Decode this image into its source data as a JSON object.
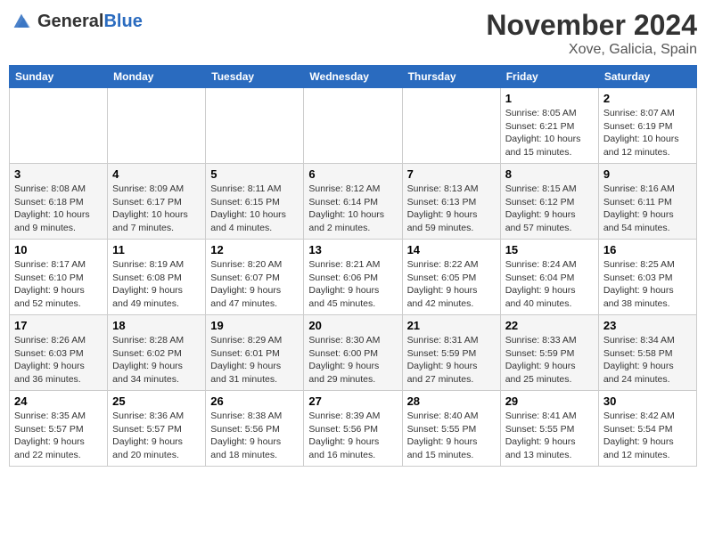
{
  "header": {
    "logo_general": "General",
    "logo_blue": "Blue",
    "month_title": "November 2024",
    "location": "Xove, Galicia, Spain"
  },
  "days_of_week": [
    "Sunday",
    "Monday",
    "Tuesday",
    "Wednesday",
    "Thursday",
    "Friday",
    "Saturday"
  ],
  "weeks": [
    [
      {
        "day": "",
        "info": ""
      },
      {
        "day": "",
        "info": ""
      },
      {
        "day": "",
        "info": ""
      },
      {
        "day": "",
        "info": ""
      },
      {
        "day": "",
        "info": ""
      },
      {
        "day": "1",
        "info": "Sunrise: 8:05 AM\nSunset: 6:21 PM\nDaylight: 10 hours and 15 minutes."
      },
      {
        "day": "2",
        "info": "Sunrise: 8:07 AM\nSunset: 6:19 PM\nDaylight: 10 hours and 12 minutes."
      }
    ],
    [
      {
        "day": "3",
        "info": "Sunrise: 8:08 AM\nSunset: 6:18 PM\nDaylight: 10 hours and 9 minutes."
      },
      {
        "day": "4",
        "info": "Sunrise: 8:09 AM\nSunset: 6:17 PM\nDaylight: 10 hours and 7 minutes."
      },
      {
        "day": "5",
        "info": "Sunrise: 8:11 AM\nSunset: 6:15 PM\nDaylight: 10 hours and 4 minutes."
      },
      {
        "day": "6",
        "info": "Sunrise: 8:12 AM\nSunset: 6:14 PM\nDaylight: 10 hours and 2 minutes."
      },
      {
        "day": "7",
        "info": "Sunrise: 8:13 AM\nSunset: 6:13 PM\nDaylight: 9 hours and 59 minutes."
      },
      {
        "day": "8",
        "info": "Sunrise: 8:15 AM\nSunset: 6:12 PM\nDaylight: 9 hours and 57 minutes."
      },
      {
        "day": "9",
        "info": "Sunrise: 8:16 AM\nSunset: 6:11 PM\nDaylight: 9 hours and 54 minutes."
      }
    ],
    [
      {
        "day": "10",
        "info": "Sunrise: 8:17 AM\nSunset: 6:10 PM\nDaylight: 9 hours and 52 minutes."
      },
      {
        "day": "11",
        "info": "Sunrise: 8:19 AM\nSunset: 6:08 PM\nDaylight: 9 hours and 49 minutes."
      },
      {
        "day": "12",
        "info": "Sunrise: 8:20 AM\nSunset: 6:07 PM\nDaylight: 9 hours and 47 minutes."
      },
      {
        "day": "13",
        "info": "Sunrise: 8:21 AM\nSunset: 6:06 PM\nDaylight: 9 hours and 45 minutes."
      },
      {
        "day": "14",
        "info": "Sunrise: 8:22 AM\nSunset: 6:05 PM\nDaylight: 9 hours and 42 minutes."
      },
      {
        "day": "15",
        "info": "Sunrise: 8:24 AM\nSunset: 6:04 PM\nDaylight: 9 hours and 40 minutes."
      },
      {
        "day": "16",
        "info": "Sunrise: 8:25 AM\nSunset: 6:03 PM\nDaylight: 9 hours and 38 minutes."
      }
    ],
    [
      {
        "day": "17",
        "info": "Sunrise: 8:26 AM\nSunset: 6:03 PM\nDaylight: 9 hours and 36 minutes."
      },
      {
        "day": "18",
        "info": "Sunrise: 8:28 AM\nSunset: 6:02 PM\nDaylight: 9 hours and 34 minutes."
      },
      {
        "day": "19",
        "info": "Sunrise: 8:29 AM\nSunset: 6:01 PM\nDaylight: 9 hours and 31 minutes."
      },
      {
        "day": "20",
        "info": "Sunrise: 8:30 AM\nSunset: 6:00 PM\nDaylight: 9 hours and 29 minutes."
      },
      {
        "day": "21",
        "info": "Sunrise: 8:31 AM\nSunset: 5:59 PM\nDaylight: 9 hours and 27 minutes."
      },
      {
        "day": "22",
        "info": "Sunrise: 8:33 AM\nSunset: 5:59 PM\nDaylight: 9 hours and 25 minutes."
      },
      {
        "day": "23",
        "info": "Sunrise: 8:34 AM\nSunset: 5:58 PM\nDaylight: 9 hours and 24 minutes."
      }
    ],
    [
      {
        "day": "24",
        "info": "Sunrise: 8:35 AM\nSunset: 5:57 PM\nDaylight: 9 hours and 22 minutes."
      },
      {
        "day": "25",
        "info": "Sunrise: 8:36 AM\nSunset: 5:57 PM\nDaylight: 9 hours and 20 minutes."
      },
      {
        "day": "26",
        "info": "Sunrise: 8:38 AM\nSunset: 5:56 PM\nDaylight: 9 hours and 18 minutes."
      },
      {
        "day": "27",
        "info": "Sunrise: 8:39 AM\nSunset: 5:56 PM\nDaylight: 9 hours and 16 minutes."
      },
      {
        "day": "28",
        "info": "Sunrise: 8:40 AM\nSunset: 5:55 PM\nDaylight: 9 hours and 15 minutes."
      },
      {
        "day": "29",
        "info": "Sunrise: 8:41 AM\nSunset: 5:55 PM\nDaylight: 9 hours and 13 minutes."
      },
      {
        "day": "30",
        "info": "Sunrise: 8:42 AM\nSunset: 5:54 PM\nDaylight: 9 hours and 12 minutes."
      }
    ]
  ]
}
